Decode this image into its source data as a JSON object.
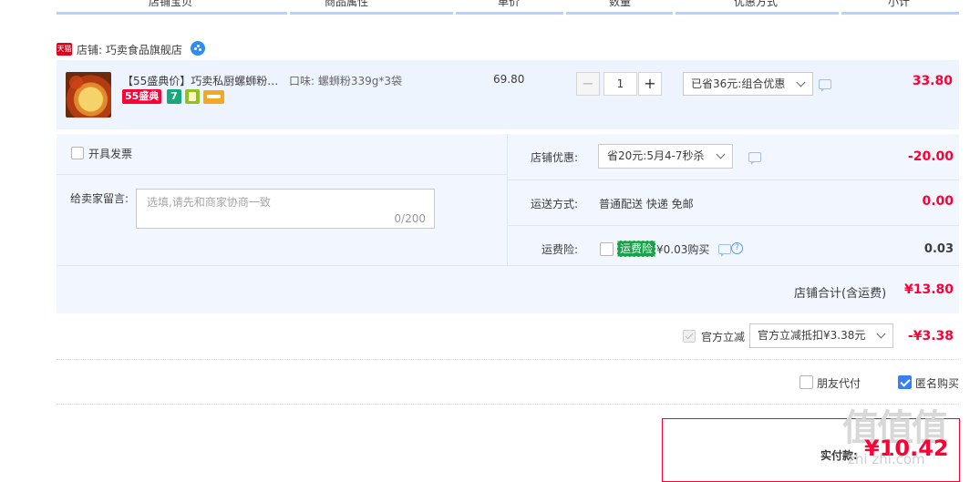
{
  "header": {
    "columns": [
      "店铺宝贝",
      "商品属性",
      "单价",
      "数量",
      "优惠方式",
      "小计"
    ]
  },
  "shop": {
    "tmall_badge": "天猫",
    "name": "店铺: 巧卖食品旗舰店"
  },
  "item": {
    "title": "【55盛典价】巧卖私厨螺蛳粉3...",
    "badge": "55盛典",
    "badge_icon_label": "7",
    "attribute": "口味: 螺蛳粉339g*3袋",
    "unit_price": "69.80",
    "quantity": "1",
    "minus": "−",
    "plus": "+",
    "promotion": "已省36元:组合优惠",
    "subtotal": "33.80"
  },
  "options": {
    "invoice_label": "开具发票",
    "message_label": "给卖家留言:",
    "message_placeholder": "选填,请先和商家协商一致",
    "message_count": "0/200",
    "shop_discount_label": "店铺优惠:",
    "shop_discount_value": "省20元:5月4-7秒杀",
    "shop_discount_amount": "-20.00",
    "shipping_label": "运送方式:",
    "shipping_value": "普通配送 快递 免邮",
    "shipping_amount": "0.00",
    "insurance_label": "运费险:",
    "insurance_tag": "运费险",
    "insurance_price": "¥0.03购买",
    "insurance_amount": "0.03"
  },
  "shop_total": {
    "label": "店铺合计(含运费)",
    "value": "¥13.80"
  },
  "official_discount": {
    "label": "官方立减",
    "select": "官方立减抵扣¥3.38元",
    "amount": "-¥3.38"
  },
  "options2": {
    "friend_pay": "朋友代付",
    "anonymous": "匿名购买"
  },
  "pay": {
    "label": "实付款:",
    "amount": "¥10.42"
  },
  "watermark": {
    "big": "值值值",
    "url": "zhi zhi.com"
  },
  "colors": {
    "accent_red": "#ff0036",
    "highlight_bg": "#eef4fd",
    "check_blue": "#3a7ff0"
  }
}
